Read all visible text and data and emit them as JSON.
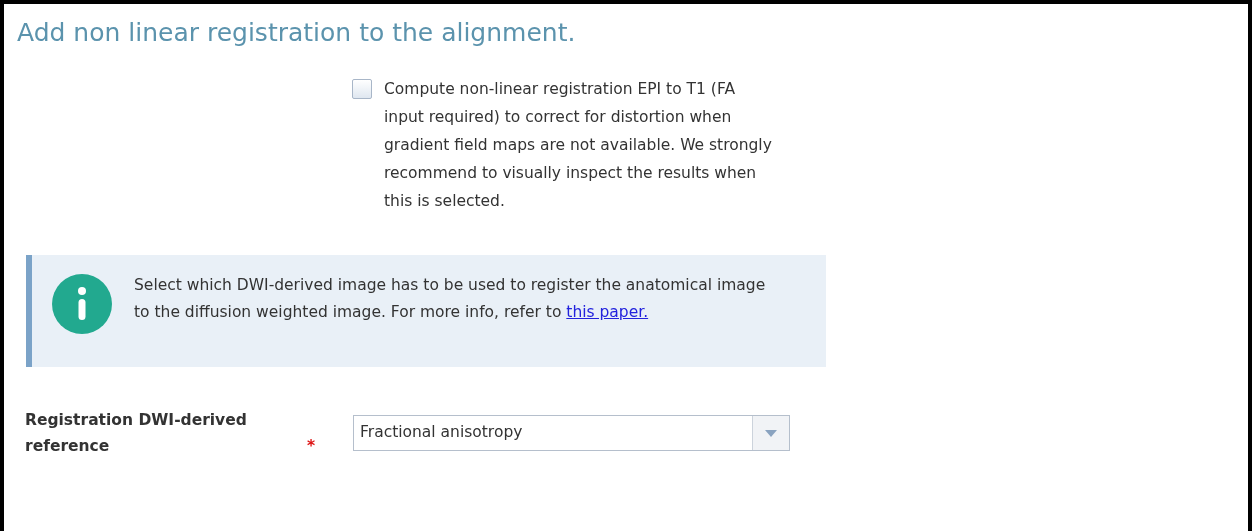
{
  "title": "Add non linear registration to the alignment.",
  "nonlinear_option": {
    "label": "Compute non-linear registration EPI to T1 (FA input required) to correct for distortion when gradient field maps are not available. We strongly recommend to visually inspect the results when this is selected.",
    "checked": false
  },
  "info": {
    "text": "Select which DWI-derived image has to be used to register the anatomical image to the diffusion weighted image. For more info, refer to ",
    "link": "this paper."
  },
  "reference_field": {
    "label": "Registration DWI-derived reference",
    "required_mark": "*",
    "value": "Fractional anisotropy"
  }
}
